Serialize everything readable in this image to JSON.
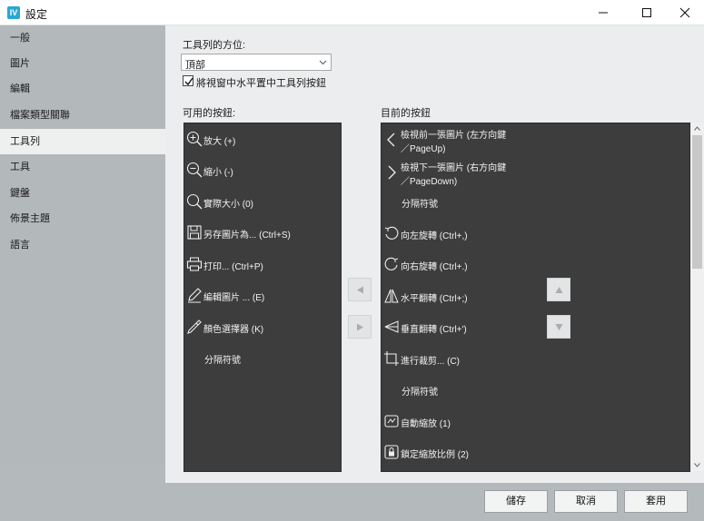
{
  "window": {
    "title": "設定",
    "icon": "app-logo-icon",
    "controls": [
      "minimize-icon",
      "maximize-icon",
      "close-icon"
    ]
  },
  "sidebar": {
    "items": [
      {
        "label": "一般"
      },
      {
        "label": "圖片"
      },
      {
        "label": "編輯"
      },
      {
        "label": "檔案類型關聯"
      },
      {
        "label": "工具列",
        "active": true
      },
      {
        "label": "工具"
      },
      {
        "label": "鍵盤"
      },
      {
        "label": "佈景主題"
      },
      {
        "label": "語言"
      }
    ]
  },
  "toolbar_settings": {
    "position_label": "工具列的方位:",
    "position_value": "頂部",
    "center_checkbox_label": "將視窗中水平置中工具列按鈕",
    "center_checked": true
  },
  "available": {
    "heading": "可用的按鈕:",
    "items": [
      {
        "label": "放大 (+)",
        "icon": "zoom-in-icon"
      },
      {
        "label": "縮小 (-)",
        "icon": "zoom-out-icon"
      },
      {
        "label": "實際大小 (0)",
        "icon": "actual-size-icon"
      },
      {
        "label": "另存圖片為... (Ctrl+S)",
        "icon": "save-icon"
      },
      {
        "label": "打印... (Ctrl+P)",
        "icon": "printer-icon"
      },
      {
        "label": "編輯圖片 ... (E)",
        "icon": "pen-icon"
      },
      {
        "label": "顏色選擇器 (K)",
        "icon": "color-picker-icon"
      },
      {
        "label": "分隔符號",
        "icon": ""
      }
    ]
  },
  "current": {
    "heading": "目前的按鈕",
    "items": [
      {
        "label": "檢視前一張圖片 (左方向鍵",
        "label2": "／PageUp)",
        "icon": "chevron-left-icon"
      },
      {
        "label": "檢視下一張圖片 (右方向鍵",
        "label2": "／PageDown)",
        "icon": "chevron-right-icon"
      },
      {
        "label": "分隔符號",
        "icon": ""
      },
      {
        "label": "向左旋轉 (Ctrl+,)",
        "icon": "rotate-left-icon"
      },
      {
        "label": "向右旋轉 (Ctrl+.)",
        "icon": "rotate-right-icon"
      },
      {
        "label": "水平翻轉 (Ctrl+;)",
        "icon": "flip-horizontal-icon"
      },
      {
        "label": "垂直翻轉 (Ctrl+')",
        "icon": "flip-vertical-icon"
      },
      {
        "label": "進行裁剪... (C)",
        "icon": "crop-icon"
      },
      {
        "label": "分隔符號",
        "icon": ""
      },
      {
        "label": "自動縮放 (1)",
        "icon": "auto-zoom-icon"
      },
      {
        "label": "鎖定縮放比例 (2)",
        "icon": "lock-zoom-icon"
      }
    ]
  },
  "buttons": {
    "save": "儲存",
    "cancel": "取消",
    "apply": "套用"
  }
}
